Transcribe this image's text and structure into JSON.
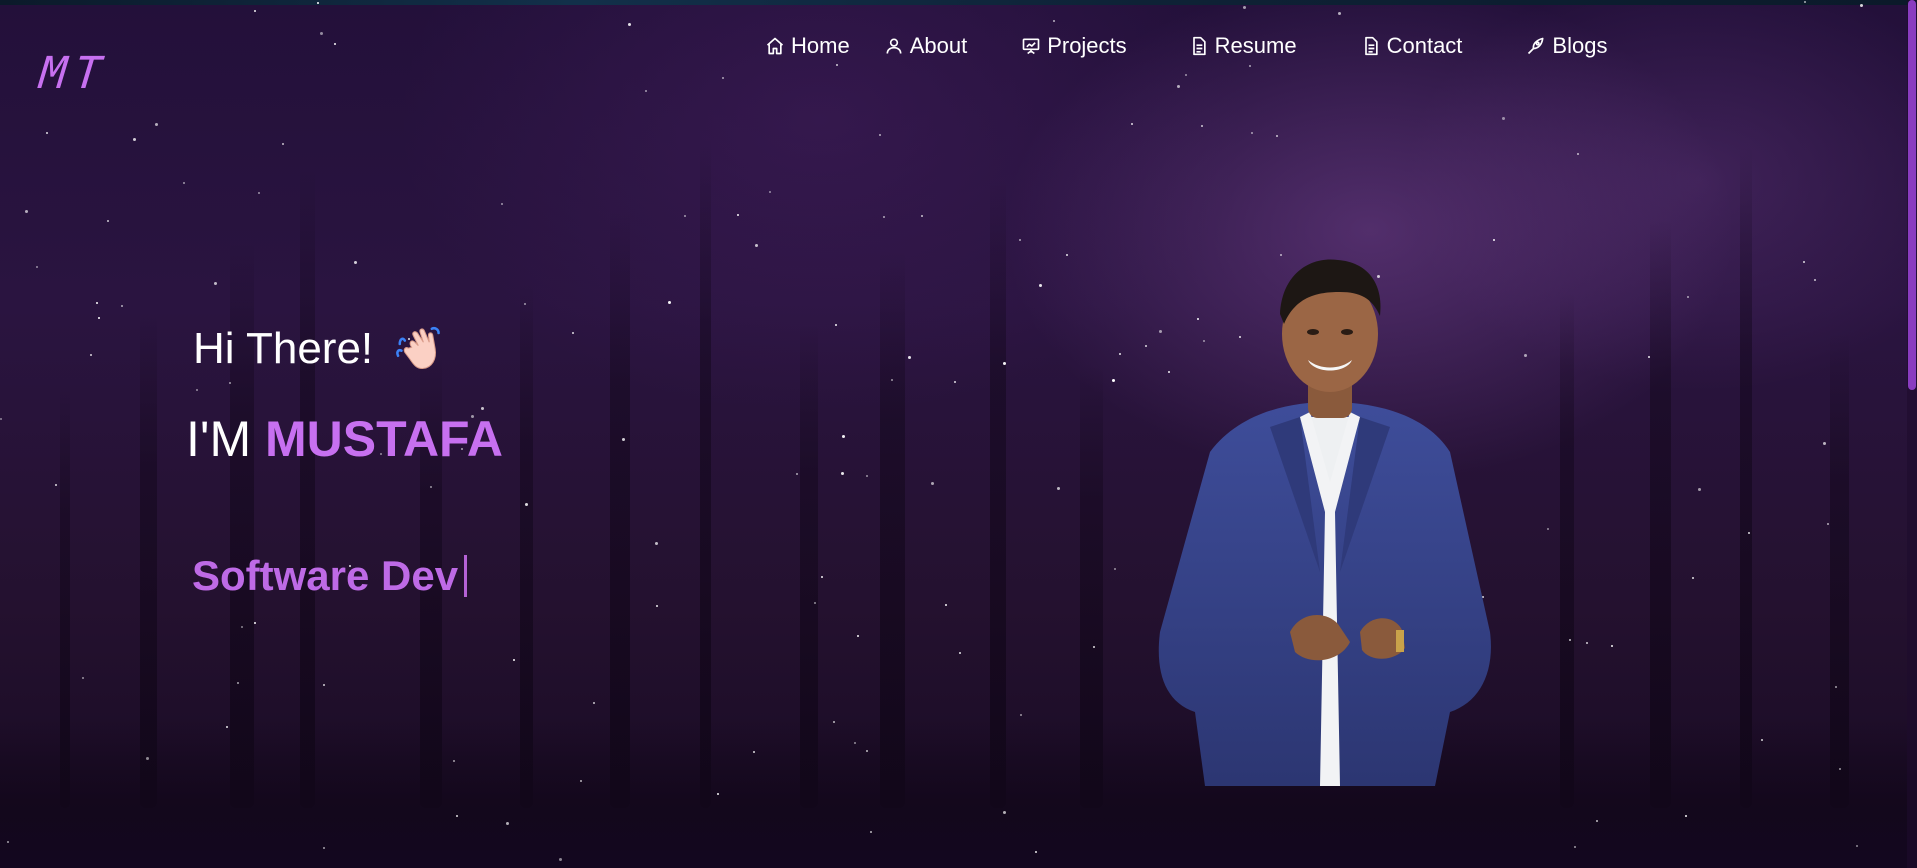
{
  "brand": {
    "logo_text": "MT"
  },
  "nav": {
    "items": [
      {
        "label": "Home",
        "icon": "home-icon"
      },
      {
        "label": "About",
        "icon": "user-icon"
      },
      {
        "label": "Projects",
        "icon": "presentation-chart-icon"
      },
      {
        "label": "Resume",
        "icon": "document-icon"
      },
      {
        "label": "Contact",
        "icon": "document-icon"
      },
      {
        "label": "Blogs",
        "icon": "pen-nib-icon"
      }
    ]
  },
  "hero": {
    "greeting": "Hi There!",
    "greeting_icon": "waving-hand-icon",
    "intro_prefix": "I'M",
    "name": "MUSTAFA",
    "typed_role": "Software Dev"
  },
  "colors": {
    "accent": "#c770f0",
    "text": "#ffffff",
    "background": "#24112f"
  }
}
